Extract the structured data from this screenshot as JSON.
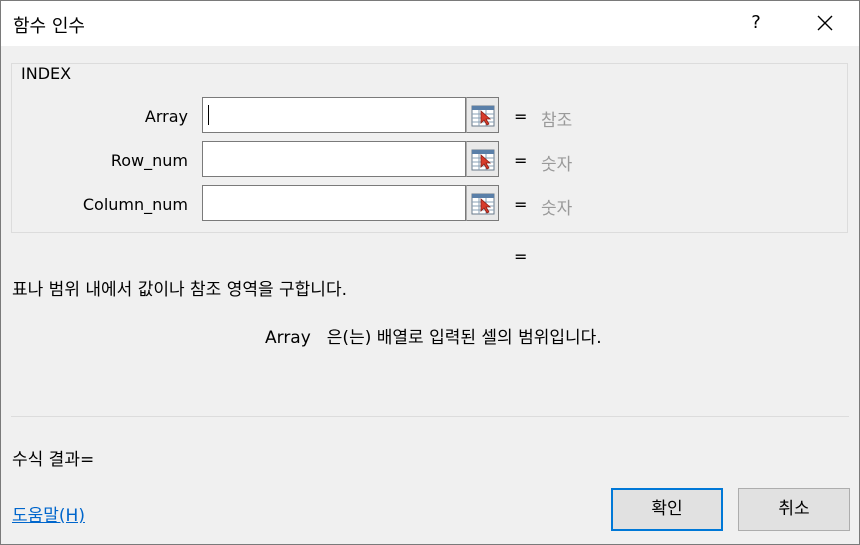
{
  "window": {
    "title": "함수 인수",
    "help_button": "?",
    "close_icon": "close-icon"
  },
  "function": {
    "name": "INDEX",
    "arguments": [
      {
        "label": "Array",
        "value": "",
        "hint": "참조"
      },
      {
        "label": "Row_num",
        "value": "",
        "hint": "숫자"
      },
      {
        "label": "Column_num",
        "value": "",
        "hint": "숫자"
      }
    ],
    "equals": "=",
    "result_equals": "=",
    "description": "표나 범위 내에서 값이나 참조 영역을 구합니다.",
    "arg_description_name": "Array",
    "arg_description_text": "은(는) 배열로 입력된 셀의 범위입니다."
  },
  "footer": {
    "formula_result": "수식 결과=",
    "help_link": "도움말(H)",
    "ok_label": "확인",
    "cancel_label": "취소"
  },
  "icons": {
    "range_select": "range-select-icon"
  },
  "colors": {
    "accent": "#0078d7",
    "link": "#0066cc",
    "hint_text": "#9a9a9a"
  }
}
